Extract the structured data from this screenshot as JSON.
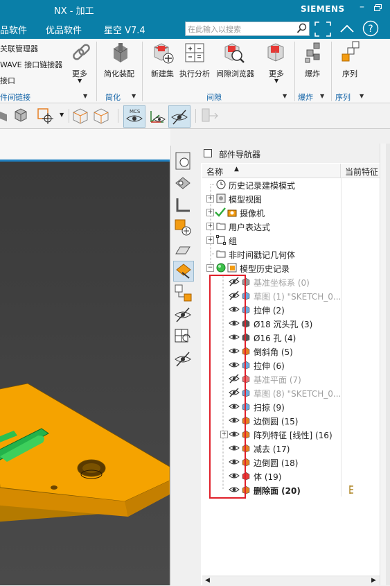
{
  "titlebar": {
    "title": "NX - 加工",
    "brand": "SIEMENS"
  },
  "menubar": {
    "items": [
      "品软件",
      "优品软件",
      "星空 V7.4"
    ],
    "search_placeholder": "在此输入以搜索"
  },
  "ribbon": {
    "left_items": [
      "关联管理器",
      "WAVE 接口链接器",
      "接口"
    ],
    "buttons": [
      {
        "label": "更多"
      },
      {
        "label": "简化装配"
      },
      {
        "label": "新建集"
      },
      {
        "label": "执行分析"
      },
      {
        "label": "间隙浏览器"
      },
      {
        "label": "更多"
      },
      {
        "label": "爆炸"
      },
      {
        "label": "序列"
      }
    ],
    "groups": [
      "件间链接",
      "简化",
      "间隙",
      "爆炸",
      "序列"
    ]
  },
  "navigator": {
    "title": "部件导航器",
    "col_name": "名称",
    "col_current": "当前特征",
    "nodes": [
      {
        "label": "历史记录建模模式"
      },
      {
        "label": "模型视图"
      },
      {
        "label": "摄像机"
      },
      {
        "label": "用户表达式"
      },
      {
        "label": "组"
      },
      {
        "label": "非时间戳记几何体"
      },
      {
        "label": "模型历史记录"
      }
    ],
    "features": [
      {
        "label": "基准坐标系 (0)",
        "dim": true
      },
      {
        "label": "草图 (1) \"SKETCH_0...",
        "dim": true
      },
      {
        "label": "拉伸 (2)"
      },
      {
        "label": "Ø18 沉头孔 (3)"
      },
      {
        "label": "Ø16 孔 (4)"
      },
      {
        "label": "倒斜角 (5)"
      },
      {
        "label": "拉伸 (6)"
      },
      {
        "label": "基准平面 (7)",
        "dim": true
      },
      {
        "label": "草图 (8) \"SKETCH_0...",
        "dim": true
      },
      {
        "label": "扫掠 (9)"
      },
      {
        "label": "边倒圆 (15)"
      },
      {
        "label": "阵列特征 [线性] (16)"
      },
      {
        "label": "减去 (17)"
      },
      {
        "label": "边倒圆 (18)"
      },
      {
        "label": "体 (19)"
      },
      {
        "label": "删除面 (20)",
        "bold": true
      }
    ]
  },
  "colors": {
    "accent": "#0a7fa8",
    "highlight": "#e0202a",
    "part": "#f5a300"
  }
}
